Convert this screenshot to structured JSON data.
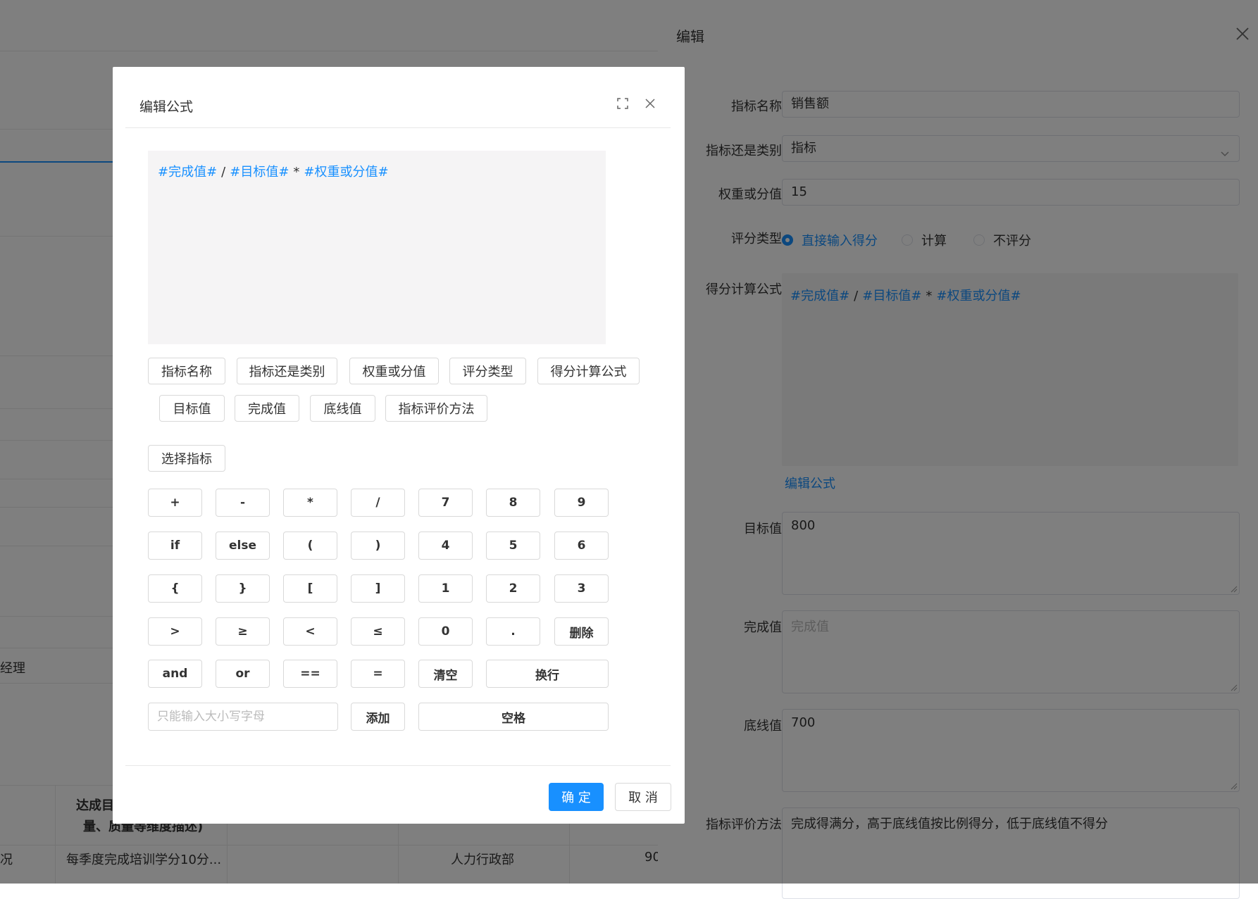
{
  "background": {
    "cells": {
      "manager": "经理",
      "achieve_header": "达成目",
      "achieve_header_2": "量、质量等维度描述)",
      "row_prefix": "况",
      "row_desc": "每季度完成培训学分10分...",
      "row_dept": "人力行政部",
      "row_num": "90"
    }
  },
  "drawer": {
    "title": "编辑",
    "fields": {
      "name_label": "指标名称",
      "name_value": "销售额",
      "type_label": "指标还是类别",
      "type_value": "指标",
      "weight_label": "权重或分值",
      "weight_value": "15",
      "score_type_label": "评分类型",
      "radio_direct": "直接输入得分",
      "radio_calc": "计算",
      "radio_none": "不评分",
      "formula_label": "得分计算公式",
      "edit_formula_link": "编辑公式",
      "target_label": "目标值",
      "target_value": "800",
      "complete_label": "完成值",
      "complete_placeholder": "完成值",
      "floor_label": "底线值",
      "floor_value": "700",
      "eval_label": "指标评价方法",
      "eval_value": "完成得满分，高于底线值按比例得分，低于底线值不得分"
    }
  },
  "formula": {
    "v1": "#完成值#",
    "op1": "/",
    "v2": "#目标值#",
    "op2": "*",
    "v3": "#权重或分值#"
  },
  "modal": {
    "title": "编辑公式",
    "field_buttons": [
      "指标名称",
      "指标还是类别",
      "权重或分值",
      "评分类型",
      "得分计算公式",
      "目标值",
      "完成值",
      "底线值",
      "指标评价方法"
    ],
    "select_indicator": "选择指标",
    "keypad": {
      "row1": [
        "+",
        "-",
        "*",
        "/",
        "7",
        "8",
        "9"
      ],
      "row2": [
        "if",
        "else",
        "(",
        ")",
        "4",
        "5",
        "6"
      ],
      "row3": [
        "{",
        "}",
        "[",
        "]",
        "1",
        "2",
        "3"
      ],
      "row4": [
        ">",
        "≥",
        "<",
        "≤",
        "0",
        ".",
        "删除"
      ],
      "row5": [
        "and",
        "or",
        "==",
        "=",
        "清空",
        "换行"
      ],
      "input_placeholder": "只能输入大小写字母",
      "add": "添加",
      "space": "空格"
    },
    "ok": "确 定",
    "cancel": "取 消"
  },
  "colors": {
    "primary": "#1890ff",
    "mask": "rgba(0,0,0,0.5)"
  }
}
